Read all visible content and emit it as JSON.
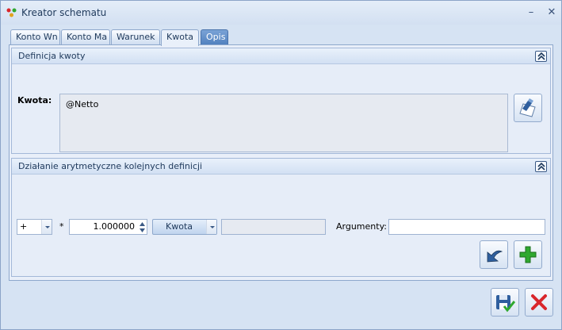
{
  "window": {
    "title": "Kreator schematu"
  },
  "title_controls": {
    "minimize_glyph": "–",
    "close_glyph": "✕"
  },
  "tabs": [
    {
      "label": "Konto Wn",
      "active": false
    },
    {
      "label": "Konto Ma",
      "active": false
    },
    {
      "label": "Warunek",
      "active": false
    },
    {
      "label": "Kwota",
      "active": true
    },
    {
      "label": "Opis",
      "active": false
    }
  ],
  "definition_group": {
    "title": "Definicja kwoty",
    "kwota_label": "Kwota:",
    "formula": "@Netto",
    "edit_button_icon": "edit-formula-icon"
  },
  "arithmetic_group": {
    "title": "Działanie arytmetyczne kolejnych definicji",
    "operator_value": "+",
    "multiply_sign": "*",
    "multiplier_value": "1.000000",
    "kwota_button_label": "Kwota",
    "kwota_value": "",
    "arguments_label": "Argumenty:",
    "arguments_value": "",
    "undo_button_icon": "undo-icon",
    "add_button_icon": "add-icon"
  },
  "footer": {
    "save_button_icon": "save-icon",
    "cancel_button_icon": "cancel-icon"
  },
  "colors": {
    "accent_blue": "#2f5f9e",
    "add_green": "#2fa82f",
    "cancel_red": "#d9262b"
  }
}
